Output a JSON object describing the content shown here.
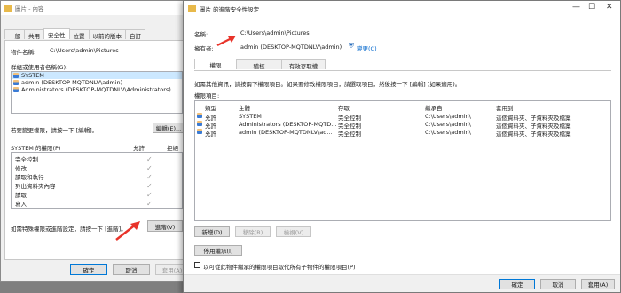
{
  "back": {
    "title": "圖片 - 內容",
    "tabs": [
      "一般",
      "共用",
      "安全性",
      "位置",
      "以前的版本",
      "自訂"
    ],
    "object_label": "物件名稱:",
    "object_value": "C:\\Users\\admin\\Pictures",
    "groups_label": "群組或使用者名稱(G):",
    "users": [
      "SYSTEM",
      "admin (DESKTOP-MQTDNLV\\admin)",
      "Administrators (DESKTOP-MQTDNLV\\Administrators)"
    ],
    "change_hint": "若要變更權限，請按一下 [編輯]。",
    "edit_button": "編輯(E)...",
    "perm_header": "SYSTEM 的權限(P)",
    "allow_header": "允許",
    "deny_header": "拒絕",
    "permissions": [
      "完全控制",
      "修改",
      "讀取和執行",
      "列出資料夾內容",
      "讀取",
      "寫入"
    ],
    "advanced_hint": "如需特殊權限或進階設定，請按一下 [進階]。",
    "advanced_button": "進階(V)",
    "ok": "確定",
    "cancel": "取消",
    "apply": "套用(A)"
  },
  "front": {
    "title": "圖片 的進階安全性設定",
    "name_label": "名稱:",
    "name_value": "C:\\Users\\admin\\Pictures",
    "owner_label": "擁有者:",
    "owner_value": "admin (DESKTOP-MQTDNLV\\admin)",
    "change_link": "變更(C)",
    "tabs": [
      "權限",
      "稽核",
      "有效存取權"
    ],
    "info_text": "如需其他資訊，請按兩下權限項目。如果要修改權限項目，請選取項目，然後按一下 [編輯] (如果適用)。",
    "entries_label": "權限項目:",
    "columns": [
      "類型",
      "主體",
      "存取",
      "繼承自",
      "套用到"
    ],
    "rows": [
      {
        "type": "允許",
        "principal": "SYSTEM",
        "access": "完全控制",
        "inherited": "C:\\Users\\admin\\",
        "applies": "這個資料夾、子資料夾及檔案"
      },
      {
        "type": "允許",
        "principal": "Administrators (DESKTOP-MQTD...",
        "access": "完全控制",
        "inherited": "C:\\Users\\admin\\",
        "applies": "這個資料夾、子資料夾及檔案"
      },
      {
        "type": "允許",
        "principal": "admin (DESKTOP-MQTDNLV\\ad...",
        "access": "完全控制",
        "inherited": "C:\\Users\\admin\\",
        "applies": "這個資料夾、子資料夾及檔案"
      }
    ],
    "add_button": "新增(D)",
    "remove_button": "移除(R)",
    "view_button": "檢視(V)",
    "disable_inherit_button": "停用繼承(I)",
    "replace_checkbox": "以可從此物件繼承的權限項目取代所有子物件的權限項目(P)",
    "ok": "確定",
    "cancel": "取消",
    "apply": "套用(A)"
  },
  "colors": {
    "accent": "#0078d7",
    "arrow": "#e8332a",
    "selection": "#cce8ff"
  }
}
